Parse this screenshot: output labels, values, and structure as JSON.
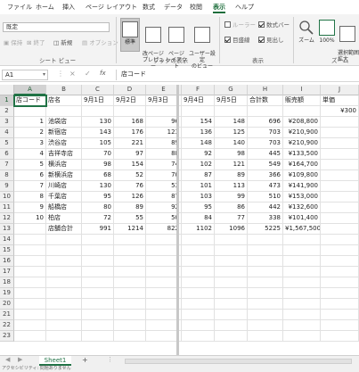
{
  "tabs": [
    "ファイル",
    "ホーム",
    "挿入",
    "ページ レイアウト",
    "数式",
    "データ",
    "校閲",
    "表示",
    "ヘルプ"
  ],
  "active_tab": "表示",
  "ribbon": {
    "sheet_view": {
      "combo_value": "既定",
      "keep": "保持",
      "exit": "終了",
      "new": "新規",
      "options": "オプション",
      "label": "シート ビュー"
    },
    "book_view": {
      "normal": "標準",
      "page_break": "改ページ\nプレビュー",
      "page_layout": "ページ\nレイアウト",
      "custom_views": "ユーザー設定\nのビュー",
      "label": "ブックの表示"
    },
    "show": {
      "ruler": "ルーラー",
      "formula_bar": "数式バー",
      "gridlines": "目盛線",
      "headings": "見出し",
      "label": "表示"
    },
    "zoom": {
      "zoom": "ズーム",
      "hundred": "100%",
      "selection": "選択範囲に\n拡大",
      "label": "ズーム"
    }
  },
  "formula_bar": {
    "name_box": "A1",
    "cancel": "×",
    "enter": "✓",
    "fx": "fx",
    "content": "店コード"
  },
  "columns": [
    "A",
    "B",
    "C",
    "D",
    "E",
    "F",
    "G",
    "H",
    "I",
    "J"
  ],
  "rows": [
    [
      "店コード",
      "店名",
      "9月1日",
      "9月2日",
      "9月3日",
      "9月4日",
      "9月5日",
      "合計数",
      "販売額",
      "単価"
    ],
    [
      "",
      "",
      "",
      "",
      "",
      "",
      "",
      "",
      "",
      "¥300"
    ],
    [
      "1",
      "池袋店",
      "130",
      "168",
      "96",
      "154",
      "148",
      "696",
      "¥208,800",
      ""
    ],
    [
      "2",
      "新宿店",
      "143",
      "176",
      "123",
      "136",
      "125",
      "703",
      "¥210,900",
      ""
    ],
    [
      "3",
      "渋谷店",
      "105",
      "221",
      "89",
      "148",
      "140",
      "703",
      "¥210,900",
      ""
    ],
    [
      "4",
      "吉祥寺店",
      "70",
      "97",
      "88",
      "92",
      "98",
      "445",
      "¥133,500",
      ""
    ],
    [
      "5",
      "横浜店",
      "98",
      "154",
      "74",
      "102",
      "121",
      "549",
      "¥164,700",
      ""
    ],
    [
      "6",
      "新横浜店",
      "68",
      "52",
      "70",
      "87",
      "89",
      "366",
      "¥109,800",
      ""
    ],
    [
      "7",
      "川崎店",
      "130",
      "76",
      "53",
      "101",
      "113",
      "473",
      "¥141,900",
      ""
    ],
    [
      "8",
      "千葉店",
      "95",
      "126",
      "87",
      "103",
      "99",
      "510",
      "¥153,000",
      ""
    ],
    [
      "9",
      "船橋店",
      "80",
      "89",
      "92",
      "95",
      "86",
      "442",
      "¥132,600",
      ""
    ],
    [
      "10",
      "柏店",
      "72",
      "55",
      "50",
      "84",
      "77",
      "338",
      "¥101,400",
      ""
    ],
    [
      "",
      "店舗合計",
      "991",
      "1214",
      "822",
      "1102",
      "1096",
      "5225",
      "¥1,567,500",
      ""
    ]
  ],
  "row_count": 23,
  "sheet_tab": "Sheet1",
  "add_sheet": "+",
  "status_text": "アクセシビリティ: 問題ありません",
  "accent_color": "#217346"
}
